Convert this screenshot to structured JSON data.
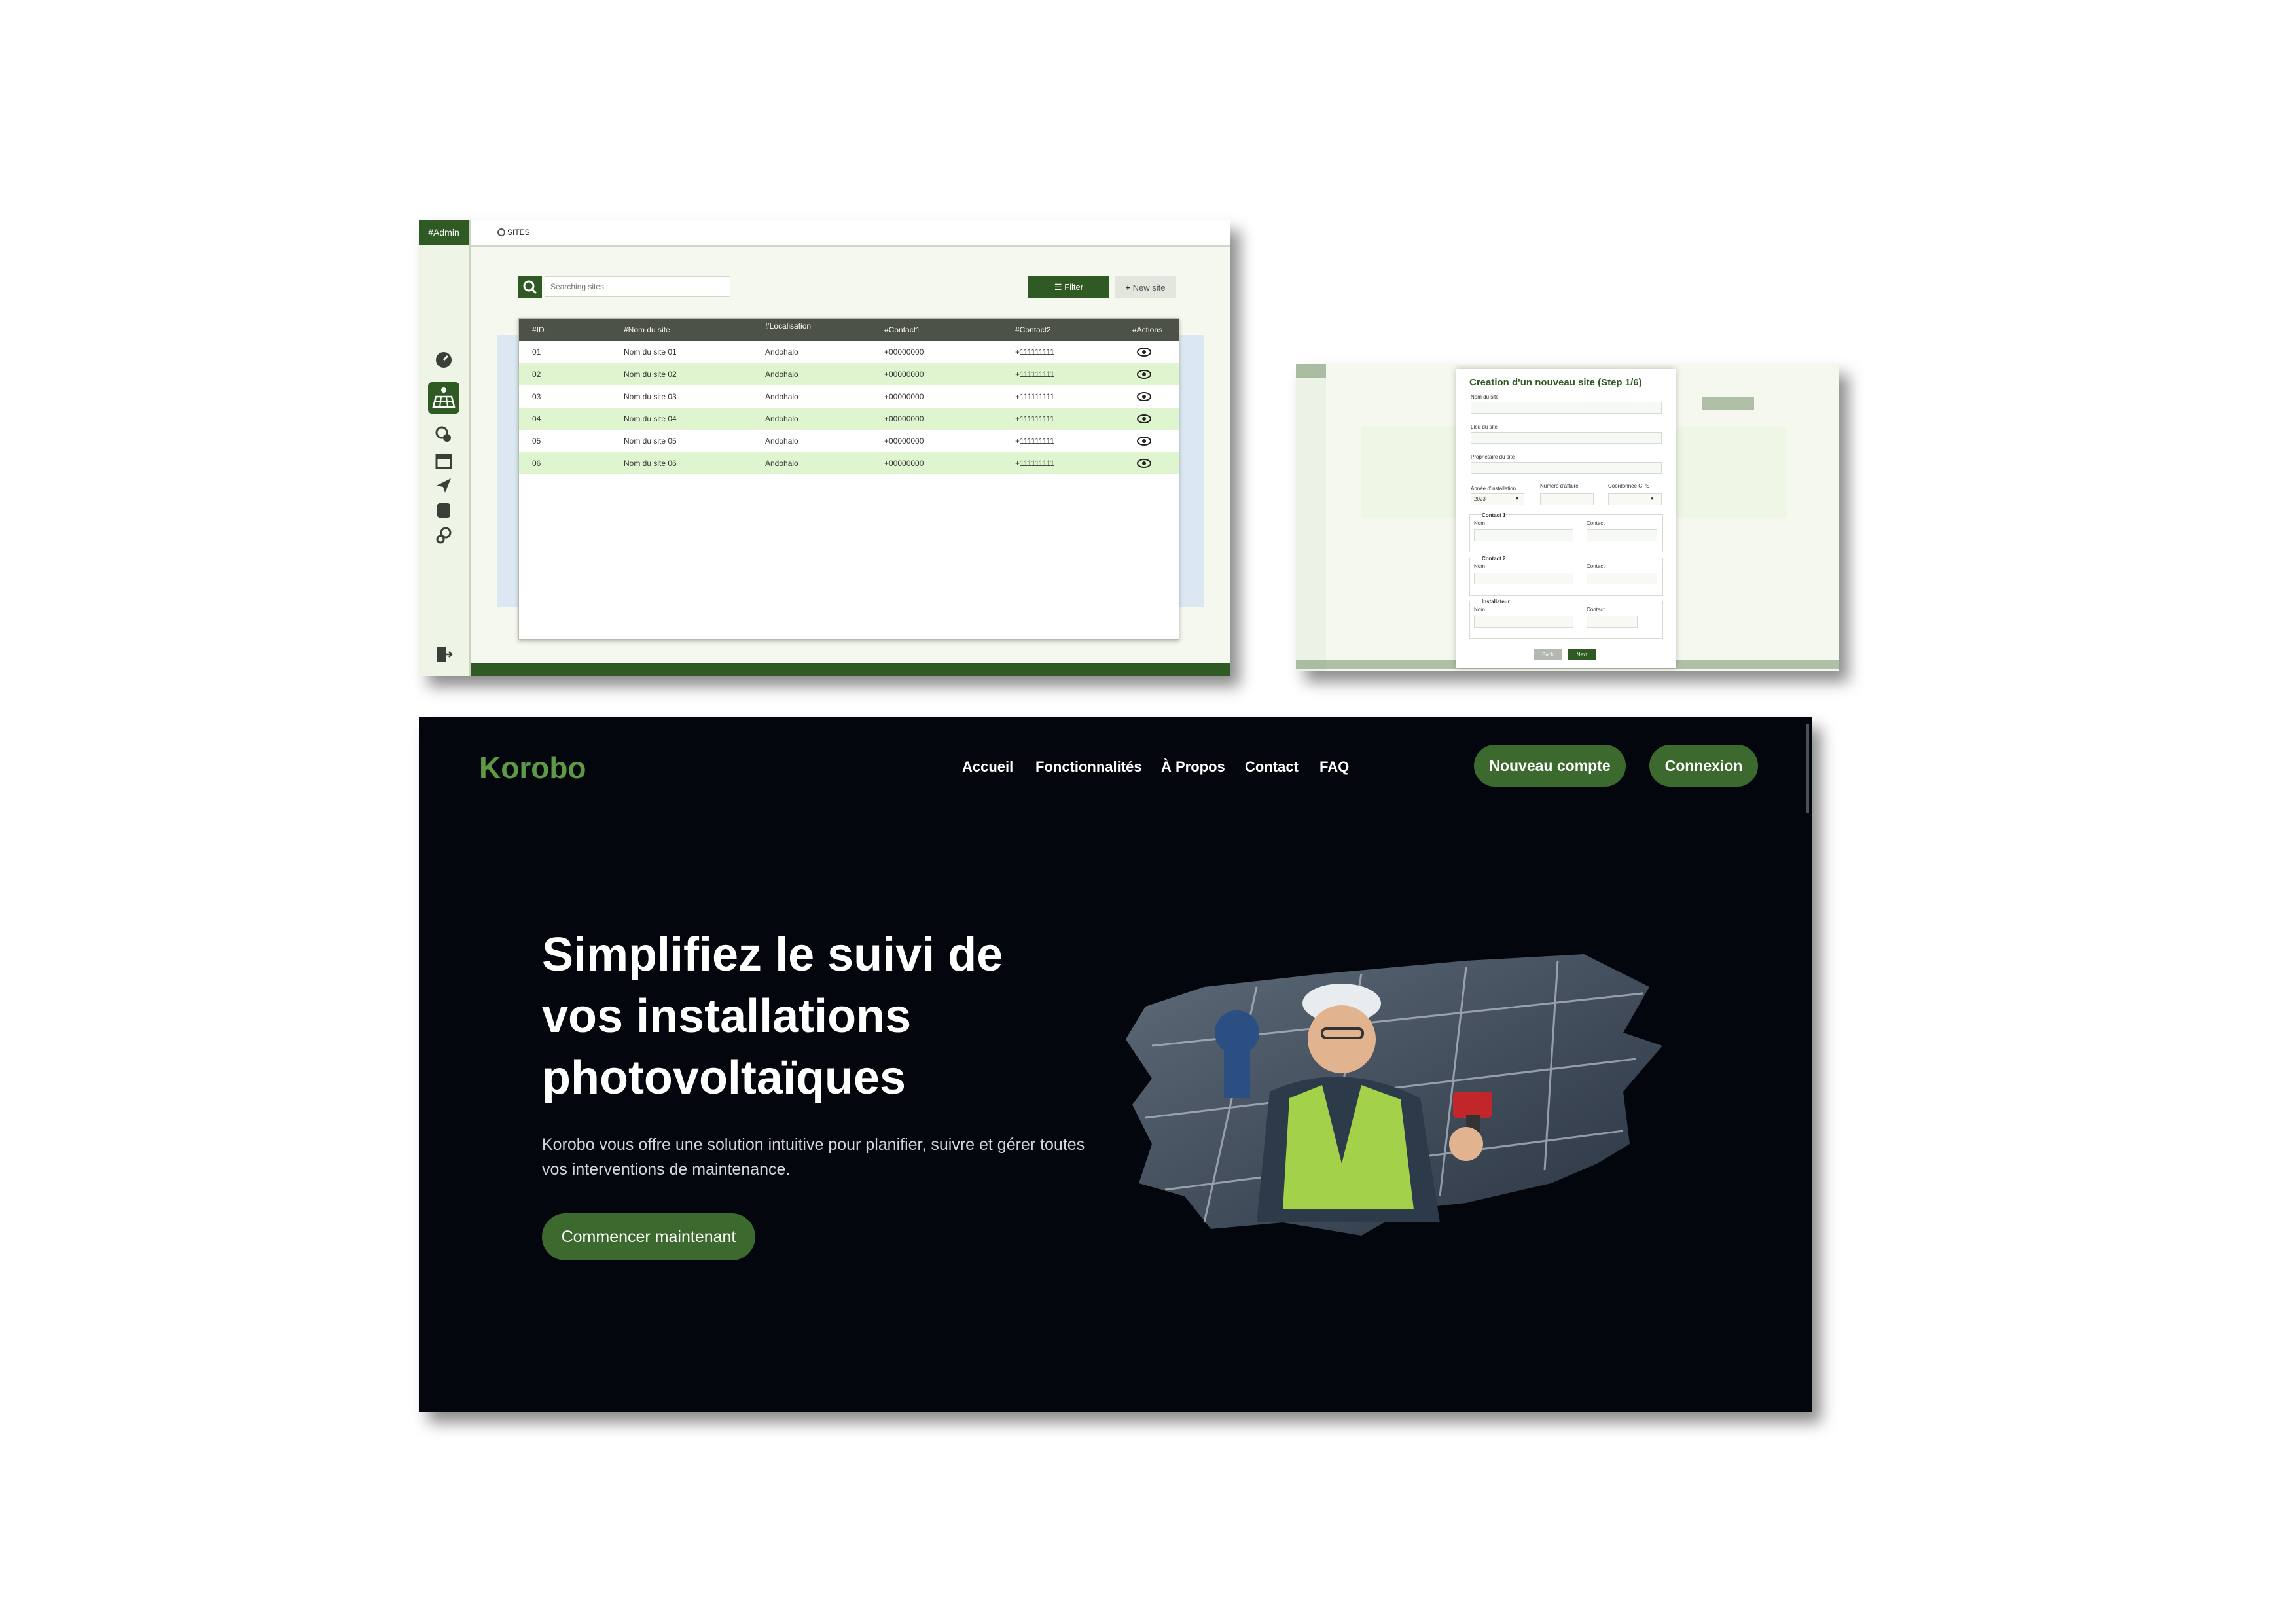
{
  "admin": {
    "badge": "#Admin",
    "tab_title": "SITES",
    "search_placeholder": "Searching sites",
    "filter_label": "Filter",
    "new_site_label": "New site",
    "sidebar_icons": [
      "dashboard-icon",
      "solar-panel-icon",
      "settings-cog-icon",
      "calendar-icon",
      "send-icon",
      "database-icon",
      "gears-icon",
      "logout-icon"
    ],
    "columns": [
      "#ID",
      "#Nom du site",
      "#Localisation",
      "#Contact1",
      "#Contact2",
      "#Actions"
    ],
    "rows": [
      {
        "id": "01",
        "name": "Nom du site 01",
        "loc": "Andohalo",
        "c1": "+00000000",
        "c2": "+111111111"
      },
      {
        "id": "02",
        "name": "Nom du site 02",
        "loc": "Andohalo",
        "c1": "+00000000",
        "c2": "+111111111"
      },
      {
        "id": "03",
        "name": "Nom du site 03",
        "loc": "Andohalo",
        "c1": "+00000000",
        "c2": "+111111111"
      },
      {
        "id": "04",
        "name": "Nom du site 04",
        "loc": "Andohalo",
        "c1": "+00000000",
        "c2": "+111111111"
      },
      {
        "id": "05",
        "name": "Nom du site 05",
        "loc": "Andohalo",
        "c1": "+00000000",
        "c2": "+111111111"
      },
      {
        "id": "06",
        "name": "Nom du site 06",
        "loc": "Andohalo",
        "c1": "+00000000",
        "c2": "+111111111"
      }
    ]
  },
  "modal": {
    "title": "Creation d'un nouveau site (Step 1/6)",
    "site_name": "Nom du site",
    "site_place": "Lieu du site",
    "owner": "Propriétaire du site",
    "install_year": "Année d'installation",
    "year_value": "2023",
    "phone": "Numero d'affaire",
    "gps": "Coordonnée GPS",
    "contact1": "Contact 1",
    "contact2": "Contact 2",
    "installer": "Installateur",
    "nom": "Nom",
    "contact": "Contact",
    "back": "Back",
    "next": "Next"
  },
  "landing": {
    "logo": "Korobo",
    "nav": [
      "Accueil",
      "Fonctionnalités",
      "À Propos",
      "Contact",
      "FAQ"
    ],
    "new_account": "Nouveau compte",
    "login": "Connexion",
    "headline_lines": [
      "Simplifiez le suivi de",
      "vos installations",
      "photovoltaïques"
    ],
    "subtitle": "Korobo vous offre une solution intuitive pour planifier, suivre et gérer toutes vos interventions de maintenance.",
    "cta": "Commencer maintenant"
  },
  "colors": {
    "brand_green": "#2f5a23",
    "accent_green": "#3c6a2e",
    "row_alt": "#dff5cf",
    "landing_bg": "#04060d"
  }
}
